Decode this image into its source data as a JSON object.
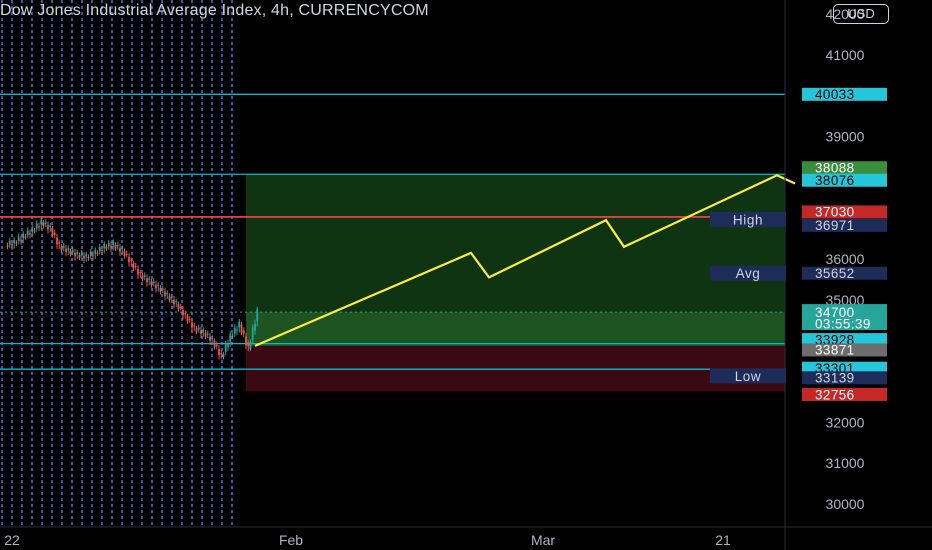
{
  "header": {
    "title": "Dow Jones Industrial Average Index, 4h, CURRENCYCOM",
    "currency": "USD"
  },
  "colors": {
    "background": "#000000",
    "bull": "#26a69a",
    "bear": "#ef5350",
    "level_line": "#00bcd4",
    "resistance_line": "#ff4444",
    "vertical_dashes": "#3f6fd8",
    "zone_profit": "#1b5e20",
    "zone_loss": "#3e0a12",
    "arrow": "#ffeb3b",
    "tag_level": "#26c6da",
    "tag_green": "#388e3c",
    "tag_red": "#c62828",
    "tag_gray": "#6d6d6d",
    "tag_navy": "#1e2c5a"
  },
  "chart_data": {
    "type": "line",
    "y_axis": {
      "ticks": [
        42000,
        41000,
        39000,
        36000,
        35000,
        32000,
        31000,
        30000
      ],
      "tick_labels": [
        "42000",
        "41000",
        "39000",
        "36000",
        "35000",
        "32000",
        "31000",
        "30000"
      ],
      "range": [
        29700,
        42200
      ]
    },
    "x_axis": {
      "labels": [
        "22",
        "Feb",
        "Mar",
        "21"
      ],
      "positions": [
        "2022-01-01",
        "2022-02-01",
        "2022-03-01",
        "2022-03-21"
      ]
    },
    "price_series": {
      "name": "",
      "dates": [
        "2022-01-01",
        "2022-01-02",
        "2022-01-03",
        "2022-01-04",
        "2022-01-05",
        "2022-01-06",
        "2022-01-07",
        "2022-01-08",
        "2022-01-09",
        "2022-01-10",
        "2022-01-11",
        "2022-01-12",
        "2022-01-13",
        "2022-01-14",
        "2022-01-15",
        "2022-01-16",
        "2022-01-17",
        "2022-01-18",
        "2022-01-19",
        "2022-01-20",
        "2022-01-21",
        "2022-01-22",
        "2022-01-23",
        "2022-01-24",
        "2022-01-25",
        "2022-01-26",
        "2022-01-27",
        "2022-01-28"
      ],
      "values": [
        36400,
        36550,
        36700,
        36900,
        36750,
        36300,
        36200,
        36100,
        36050,
        36150,
        36300,
        36350,
        36200,
        35900,
        35600,
        35450,
        35300,
        35100,
        34900,
        34600,
        34300,
        34200,
        34000,
        33600,
        34100,
        34400,
        33800,
        34700
      ]
    },
    "levels": [
      {
        "value": 40033,
        "label": "40033",
        "kind": "level"
      },
      {
        "value": 38088,
        "label": "38088",
        "kind": "target"
      },
      {
        "value": 38076,
        "label": "38076",
        "kind": "level"
      },
      {
        "value": 37030,
        "label": "37030",
        "kind": "resistance"
      },
      {
        "value": 36971,
        "label": "36971",
        "kind": "high",
        "note": "High"
      },
      {
        "value": 35652,
        "label": "35652",
        "kind": "avg",
        "note": "Avg"
      },
      {
        "value": 34700,
        "label": "34700",
        "kind": "price",
        "countdown": "03:55:39"
      },
      {
        "value": 33928,
        "label": "33928",
        "kind": "level"
      },
      {
        "value": 33871,
        "label": "33871",
        "kind": "entry"
      },
      {
        "value": 33301,
        "label": "33301",
        "kind": "level"
      },
      {
        "value": 33139,
        "label": "33139",
        "kind": "low",
        "note": "Low"
      },
      {
        "value": 32756,
        "label": "32756",
        "kind": "stop"
      }
    ],
    "position": {
      "start_date": "2022-01-27",
      "end_date": "2022-04-10",
      "entry": 33871,
      "target": 38076,
      "stop": 32756
    },
    "projection": {
      "dates": [
        "2022-01-28",
        "2022-02-21",
        "2022-02-23",
        "2022-03-08",
        "2022-03-10",
        "2022-03-27",
        "2022-03-29"
      ],
      "values": [
        33871,
        36150,
        35550,
        36950,
        36300,
        38050,
        37850
      ]
    },
    "grid": false,
    "legend": "none"
  }
}
